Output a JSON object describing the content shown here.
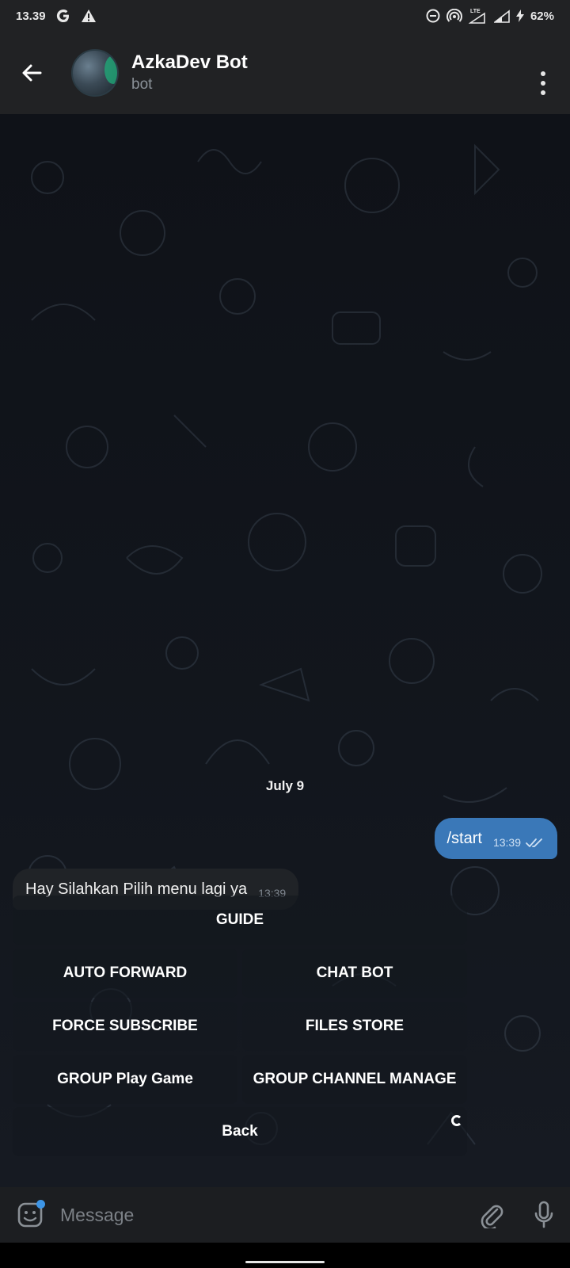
{
  "status_bar": {
    "time": "13.39",
    "battery": "62%",
    "network": "LTE"
  },
  "header": {
    "title": "AzkaDev Bot",
    "subtitle": "bot",
    "avatar_icon": "bot-avatar"
  },
  "chat": {
    "date": "July 9",
    "messages": [
      {
        "direction": "out",
        "text": "/start",
        "time": "13:39",
        "status": "read"
      },
      {
        "direction": "in",
        "text": "Hay Silahkan Pilih menu lagi ya",
        "time": "13:39"
      }
    ],
    "keyboard": [
      [
        "GUIDE"
      ],
      [
        "AUTO FORWARD",
        "CHAT BOT"
      ],
      [
        "FORCE SUBSCRIBE",
        "FILES STORE"
      ],
      [
        "GROUP Play Game",
        "GROUP CHANNEL MANAGE"
      ],
      [
        "Back"
      ]
    ]
  },
  "input": {
    "placeholder": "Message"
  },
  "colors": {
    "outgoing_bubble": "#3a78b8",
    "incoming_bubble": "#202327",
    "header_bg": "#212224",
    "unread_dot": "#3d95e6"
  }
}
